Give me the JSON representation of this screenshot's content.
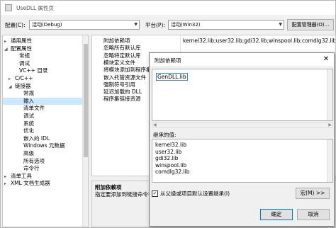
{
  "window": {
    "title": "UseDLL 属性页"
  },
  "toolbar": {
    "config_label": "配置(C):",
    "config_value": "活动(Debug)",
    "platform_label": "平台(P):",
    "platform_value": "活动(Win32)",
    "config_manager_label": "配置管理器(O)..."
  },
  "tree": {
    "items": [
      {
        "label": "通用属性",
        "expander": "▸"
      },
      {
        "label": "配置属性",
        "expander": "◢"
      },
      {
        "label": "常规",
        "expander": ""
      },
      {
        "label": "调试",
        "expander": ""
      },
      {
        "label": "VC++ 目录",
        "expander": ""
      },
      {
        "label": "C/C++",
        "expander": "▸"
      },
      {
        "label": "链接器",
        "expander": "◢"
      },
      {
        "label": "常规",
        "expander": ""
      },
      {
        "label": "输入",
        "expander": ""
      },
      {
        "label": "清单文件",
        "expander": ""
      },
      {
        "label": "调试",
        "expander": ""
      },
      {
        "label": "系统",
        "expander": ""
      },
      {
        "label": "优化",
        "expander": ""
      },
      {
        "label": "嵌入的 IDL",
        "expander": ""
      },
      {
        "label": "Windows 元数据",
        "expander": ""
      },
      {
        "label": "高级",
        "expander": ""
      },
      {
        "label": "所有选项",
        "expander": ""
      },
      {
        "label": "命令行",
        "expander": ""
      },
      {
        "label": "清单工具",
        "expander": "▸"
      },
      {
        "label": "XML 文档生成器",
        "expander": "▸"
      }
    ]
  },
  "grid": {
    "rows": [
      {
        "name": "附加依赖项",
        "value": "kernel32.lib;user32.lib;gdi32.lib;winspool.lib;comdlg32.lib"
      },
      {
        "name": "忽略所有默认库",
        "value": ""
      },
      {
        "name": "忽略特定默认库",
        "value": ""
      },
      {
        "name": "模块定义文件",
        "value": ""
      },
      {
        "name": "将模块添加到程序集",
        "value": ""
      },
      {
        "name": "嵌入托管资源文件",
        "value": ""
      },
      {
        "name": "强制符号引用",
        "value": ""
      },
      {
        "name": "延迟加载的 DLL",
        "value": ""
      },
      {
        "name": "程序集链接资源",
        "value": ""
      }
    ]
  },
  "description": {
    "title": "附加依赖项",
    "text": "指定要添加到链接命令行"
  },
  "dialog": {
    "title": "附加依赖项",
    "close_glyph": "✕",
    "edit_text": "GenDLL.lib",
    "inherited_label": "继承的值:",
    "inherited_values": [
      "kernel32.lib",
      "user32.lib",
      "gdi32.lib",
      "winspool.lib",
      "comdlg32.lib"
    ],
    "inherit_checkbox_label": "从父级或项目默认设置继承(I)",
    "inherit_checked_glyph": "✓",
    "macro_button": "宏(M) >>",
    "ok_button": "确定",
    "cancel_button": "取消"
  }
}
